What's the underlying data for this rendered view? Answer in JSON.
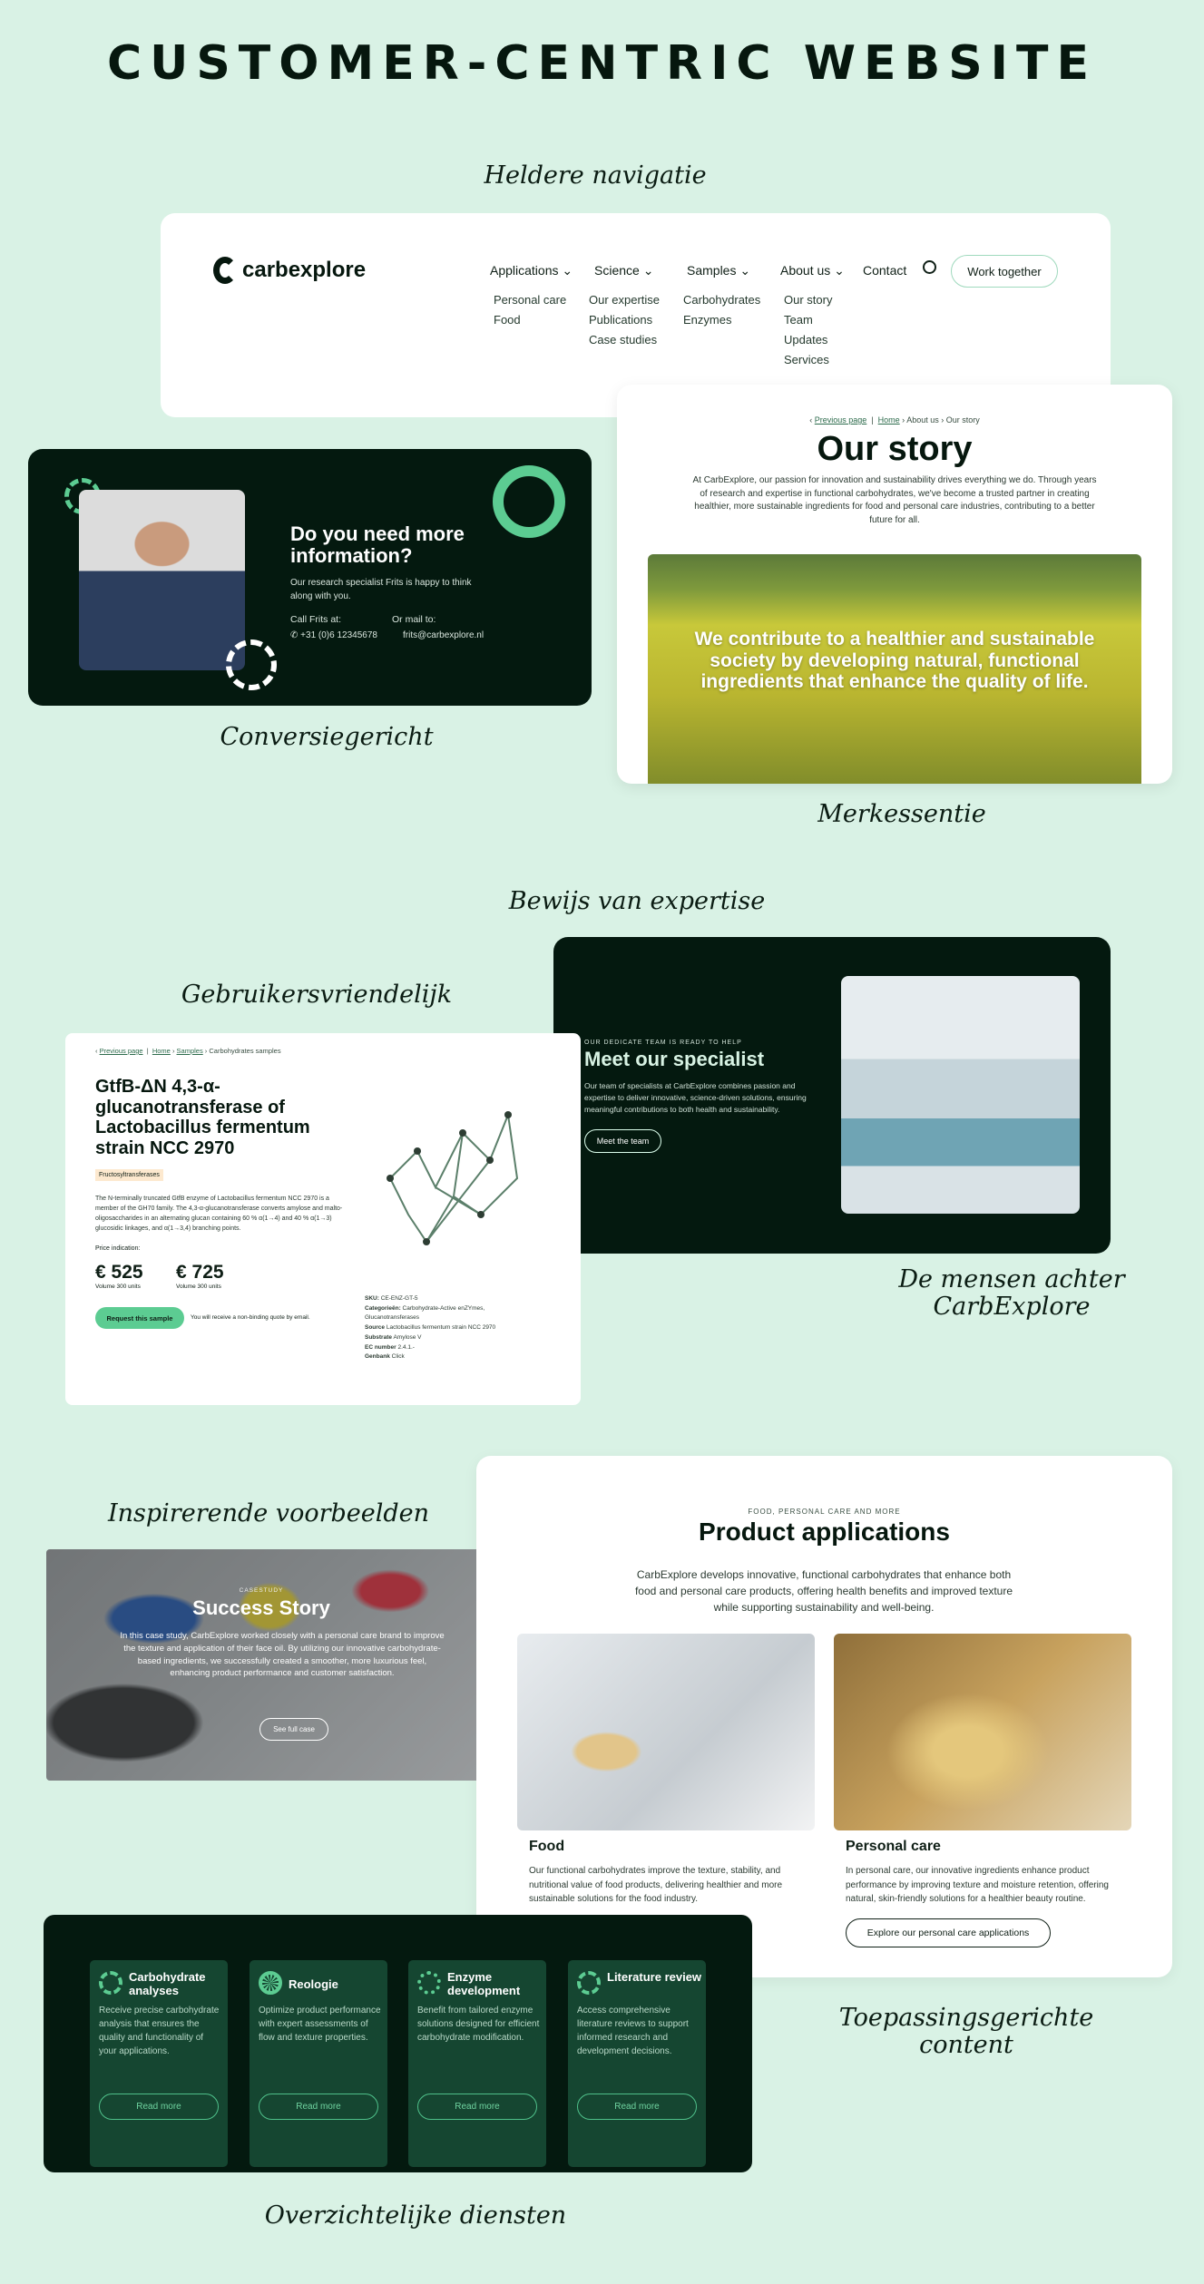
{
  "page_title": "CUSTOMER-CENTRIC WEBSITE",
  "captions": {
    "nav": "Heldere navigatie",
    "conversion": "Conversiegericht",
    "brand": "Merkessentie",
    "expertise": "Bewijs van expertise",
    "usability": "Gebruikersvriendelijk",
    "people_1": "De mensen achter",
    "people_2": "CarbExplore",
    "inspiring": "Inspirerende voorbeelden",
    "applied_1": "Toepassingsgerichte",
    "applied_2": "content",
    "services": "Overzichtelijke diensten"
  },
  "colors": {
    "background": "#d9f2e5",
    "dark": "#04190f",
    "accent": "#5ccc92"
  },
  "nav": {
    "logo": "carbexplore",
    "items": [
      {
        "label": "Applications",
        "sub": [
          "Personal care",
          "Food"
        ]
      },
      {
        "label": "Science",
        "sub": [
          "Our expertise",
          "Publications",
          "Case studies"
        ]
      },
      {
        "label": "Samples",
        "sub": [
          "Carbohydrates",
          "Enzymes"
        ]
      },
      {
        "label": "About us",
        "sub": [
          "Our story",
          "Team",
          "Updates",
          "Services"
        ]
      }
    ],
    "contact": "Contact",
    "cta": "Work together",
    "search_icon": "search-icon"
  },
  "contact_card": {
    "heading": "Do you need more information?",
    "text": "Our research specialist Frits is happy to think along with you.",
    "call_label": "Call Frits at:",
    "phone": "+31 (0)6 12345678",
    "mail_label": "Or mail to:",
    "email": "frits@carbexplore.nl"
  },
  "story": {
    "breadcrumb": {
      "prev": "Previous page",
      "home": "Home",
      "about": "About us",
      "current": "Our story"
    },
    "title": "Our story",
    "text": "At CarbExplore, our passion for innovation and sustainability drives everything we do. Through years of research and expertise in functional carbohydrates, we've become a trusted partner in creating healthier, more sustainable ingredients for food and personal care industries, contributing to a better future for all.",
    "quote": "We contribute to a healthier and sustainable society by developing natural, functional ingredients that enhance the quality of life."
  },
  "product": {
    "breadcrumb": {
      "prev": "Previous page",
      "home": "Home",
      "samples": "Samples",
      "current": "Carbohydrates samples"
    },
    "title": "GtfB-ΔN 4,3-α-glucanotransferase of Lactobacillus fermentum strain NCC 2970",
    "tag": "Fructosyltransferases",
    "text": "The N-terminally truncated GtfB enzyme of Lactobacillus fermentum NCC 2970 is a member of the GH70 family. The 4,3-α-glucanotransferase converts amylose and malto-oligosaccharides in an alternating glucan containing 60 % α(1→4) and 40 % α(1→3) glucosidic linkages, and α(1→3,4) branching points.",
    "price_label": "Price indication:",
    "prices": [
      {
        "price": "€ 525",
        "volume": "Volume 300 units"
      },
      {
        "price": "€ 725",
        "volume": "Volume 300 units"
      }
    ],
    "button": "Request this sample",
    "note": "You will receive a non-binding quote by email.",
    "specs": [
      {
        "k": "SKU:",
        "v": "CE-ENZ-GT-5"
      },
      {
        "k": "Categorieën:",
        "v": "Carbohydrate-Active enZYmes, Glucanotransferases"
      },
      {
        "k": "Source",
        "v": "Lactobacillus fermentum strain NCC 2970"
      },
      {
        "k": "Substrate",
        "v": "Amylose V"
      },
      {
        "k": "EC number",
        "v": "2.4.1.-"
      },
      {
        "k": "Genbank",
        "v": "Click"
      }
    ]
  },
  "specialist": {
    "eyebrow": "OUR DEDICATE TEAM IS READY TO HELP",
    "title": "Meet our specialist",
    "text": "Our team of specialists at CarbExplore combines passion and expertise to deliver innovative, science-driven solutions, ensuring meaningful contributions to both health and sustainability.",
    "button": "Meet the team"
  },
  "case": {
    "eyebrow": "CASESTUDY",
    "title": "Success Story",
    "text": "In this case study, CarbExplore worked closely with a personal care brand to improve the texture and application of their face oil. By utilizing our innovative carbohydrate-based ingredients, we successfully created a smoother, more luxurious feel, enhancing product performance and customer satisfaction.",
    "button": "See full case"
  },
  "applications": {
    "eyebrow": "FOOD, PERSONAL CARE AND MORE",
    "title": "Product applications",
    "text": "CarbExplore develops innovative, functional carbohydrates that enhance both food and personal care products, offering health benefits and improved texture while supporting sustainability and well-being.",
    "items": [
      {
        "title": "Food",
        "text": "Our functional carbohydrates improve the texture, stability, and nutritional value of food products, delivering healthier and more sustainable solutions for the food industry."
      },
      {
        "title": "Personal care",
        "text": "In personal care, our innovative ingredients enhance product performance by improving texture and moisture retention, offering natural, skin-friendly solutions for a healthier beauty routine.",
        "button": "Explore our personal care applications"
      }
    ]
  },
  "services": [
    {
      "title": "Carbohydrate analyses",
      "text": "Receive precise carbohydrate analysis that ensures the quality and functionality of your applications.",
      "button": "Read more"
    },
    {
      "title": "Reologie",
      "text": "Optimize product performance with expert assessments of flow and texture properties.",
      "button": "Read more"
    },
    {
      "title": "Enzyme development",
      "text": "Benefit from tailored enzyme solutions designed for efficient carbohydrate modification.",
      "button": "Read more"
    },
    {
      "title": "Literature review",
      "text": "Access comprehensive literature reviews to support informed research and development decisions.",
      "button": "Read more"
    }
  ]
}
